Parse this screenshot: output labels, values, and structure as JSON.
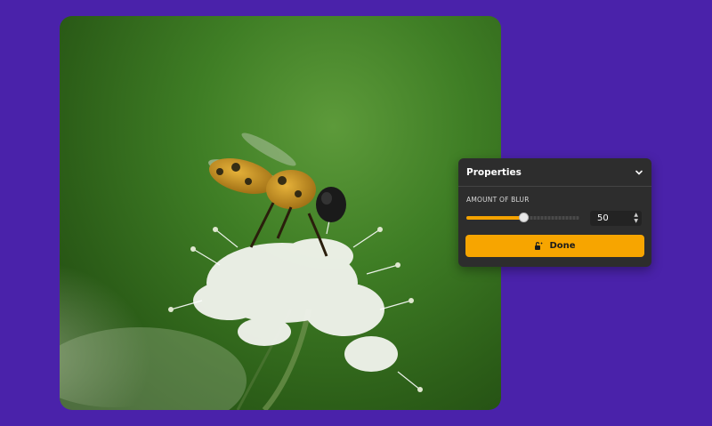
{
  "photo": {
    "subject": "bee-on-white-flower"
  },
  "properties_panel": {
    "title": "Properties",
    "collapse_icon": "chevron-down-icon",
    "blur": {
      "label": "AMOUNT OF BLUR",
      "value": "50",
      "slider_fraction": 0.5
    },
    "done_label": "Done",
    "done_icon": "unlock-sparkle-icon"
  },
  "colors": {
    "background": "#4a22aa",
    "panel": "#2d2d2d",
    "accent": "#f7a500"
  }
}
